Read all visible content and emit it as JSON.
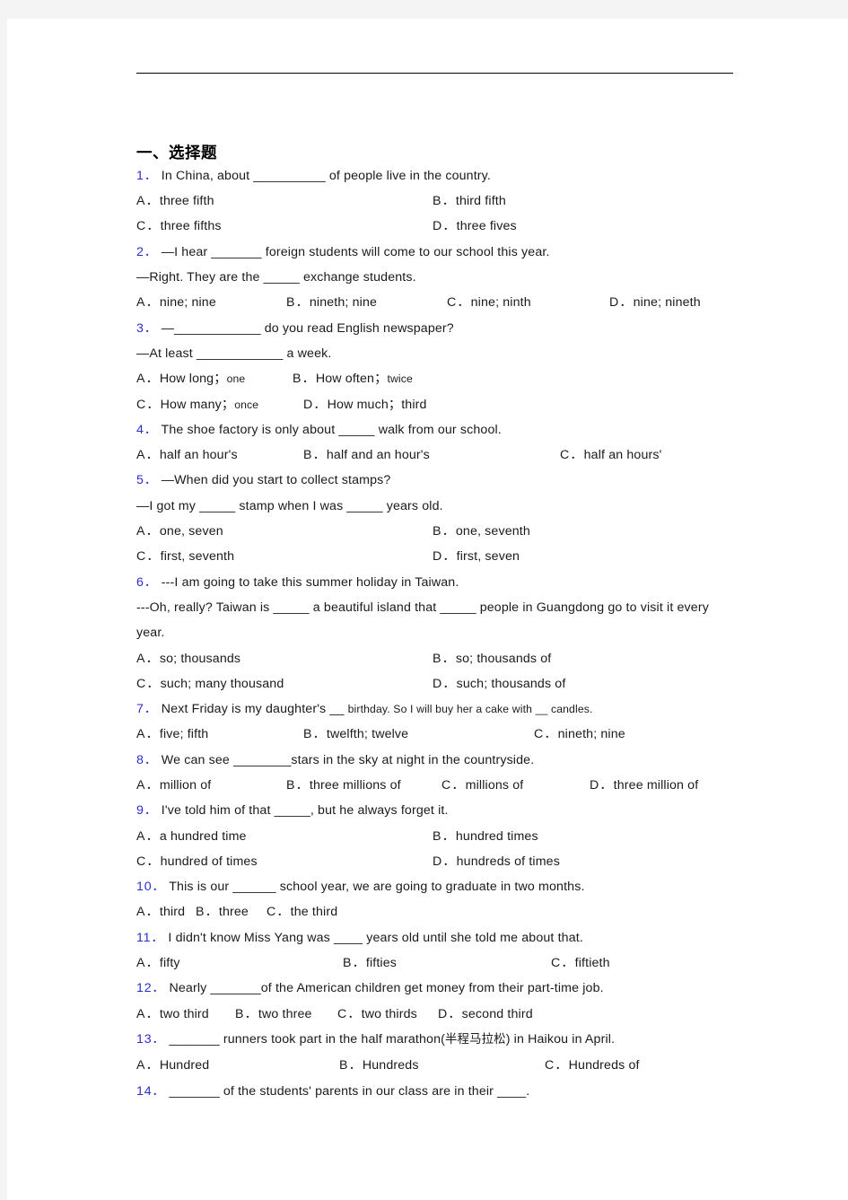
{
  "document": {
    "heading": "一、选择题",
    "questions": [
      {
        "number": "1．",
        "text": "In China, about __________ of people live in the country.",
        "layout": "2col",
        "options": [
          {
            "label": "A．",
            "text": "three fifth"
          },
          {
            "label": "B．",
            "text": "third fifth"
          },
          {
            "label": "C．",
            "text": "three fifths"
          },
          {
            "label": "D．",
            "text": "three fives"
          }
        ]
      },
      {
        "number": "2．",
        "text": "—I hear _______ foreign students will come to our school this year.",
        "text2": "—Right. They are the _____ exchange students.",
        "layout": "4col",
        "options": [
          {
            "label": "A．",
            "text": "nine; nine"
          },
          {
            "label": "B．",
            "text": "nineth; nine"
          },
          {
            "label": "C．",
            "text": "nine; ninth"
          },
          {
            "label": "D．",
            "text": "nine; nineth"
          }
        ]
      },
      {
        "number": "3．",
        "text": "—____________ do you read English newspaper?",
        "text2": " —At least ____________ a week.",
        "layout": "inline2",
        "options": [
          {
            "label": "A．",
            "text": "How long",
            "sep": "；",
            "small": "one"
          },
          {
            "label": "B．",
            "text": "How often",
            "sep": "；",
            "small": "twice"
          },
          {
            "label": "C．",
            "text": "How many",
            "sep": "；",
            "small": "once"
          },
          {
            "label": "D．",
            "text": "How much",
            "sep": "；",
            "small": "third"
          }
        ]
      },
      {
        "number": "4．",
        "text": "The shoe factory is only about _____ walk from our school.",
        "layout": "3col",
        "options": [
          {
            "label": "A．",
            "text": "half an hour's"
          },
          {
            "label": "B．",
            "text": "half and an hour's"
          },
          {
            "label": "C．",
            "text": "half an hours'"
          }
        ]
      },
      {
        "number": "5．",
        "text": "—When did you start to collect stamps?",
        "text2": "—I got my _____ stamp when I was _____ years old.",
        "layout": "2col",
        "options": [
          {
            "label": "A．",
            "text": "one, seven"
          },
          {
            "label": "B．",
            "text": "one, seventh"
          },
          {
            "label": "C．",
            "text": "first, seventh"
          },
          {
            "label": "D．",
            "text": "first, seven"
          }
        ]
      },
      {
        "number": "6．",
        "text": "---I am going to take this summer holiday in Taiwan.",
        "text2": "---Oh, really? Taiwan is _____ a beautiful island that _____ people in Guangdong go to visit it every year.",
        "layout": "2col",
        "options": [
          {
            "label": "A．",
            "text": "so; thousands"
          },
          {
            "label": "B．",
            "text": "so; thousands of"
          },
          {
            "label": "C．",
            "text": "such; many thousand"
          },
          {
            "label": "D．",
            "text": "such; thousands of"
          }
        ]
      },
      {
        "number": "7．",
        "text_a": "Next Friday is my daughter's __ ",
        "text_b": "birthday. So I will buy her a cake with __ candles.",
        "layout": "3col",
        "options": [
          {
            "label": "A．",
            "text": "five; fifth"
          },
          {
            "label": "B．",
            "text": "twelfth; twelve"
          },
          {
            "label": "C．",
            "text": "nineth; nine"
          }
        ]
      },
      {
        "number": "8．",
        "text": "We can see ________stars in the sky at night in the countryside.",
        "layout": "4col",
        "options": [
          {
            "label": "A．",
            "text": "million of"
          },
          {
            "label": "B．",
            "text": "three millions of"
          },
          {
            "label": "C．",
            "text": "millions of"
          },
          {
            "label": "D．",
            "text": "three million of"
          }
        ]
      },
      {
        "number": "9．",
        "text": "I've told him of that _____, but he always forget it.",
        "layout": "2col",
        "options": [
          {
            "label": "A．",
            "text": "a hundred time"
          },
          {
            "label": "B．",
            "text": "hundred times"
          },
          {
            "label": "C．",
            "text": "hundred of times"
          },
          {
            "label": "D．",
            "text": "hundreds of times"
          }
        ]
      },
      {
        "number": "10．",
        "text": "This is our ______ school year, we are going to graduate in two months.",
        "layout": "inline3",
        "options": [
          {
            "label": "A．",
            "text": "third"
          },
          {
            "label": "B．",
            "text": "three"
          },
          {
            "label": "C．",
            "text": "the third"
          }
        ]
      },
      {
        "number": "11．",
        "text": "I didn't know Miss Yang was ____  years old until she told me about that.",
        "layout": "3col",
        "options": [
          {
            "label": "A．",
            "text": "fifty"
          },
          {
            "label": "B．",
            "text": "fifties"
          },
          {
            "label": "C．",
            "text": "fiftieth"
          }
        ]
      },
      {
        "number": "12．",
        "text": "Nearly _______of the American children get money from their part-time job.",
        "layout": "inline4",
        "options": [
          {
            "label": "A．",
            "text": "two third"
          },
          {
            "label": "B．",
            "text": "two three"
          },
          {
            "label": "C．",
            "text": "two thirds"
          },
          {
            "label": "D．",
            "text": "second third"
          }
        ]
      },
      {
        "number": "13．",
        "text_pre": " _______ runners took part in the half marathon(",
        "text_cn": "半程马拉松",
        "text_post": ") in Haikou in April.",
        "layout": "3col",
        "options": [
          {
            "label": "A．",
            "text": "Hundred"
          },
          {
            "label": "B．",
            "text": "Hundreds"
          },
          {
            "label": "C．",
            "text": "Hundreds of"
          }
        ]
      },
      {
        "number": "14．",
        "text": " _______ of the students' parents in our class are in their ____.",
        "layout": "none",
        "options": []
      }
    ]
  }
}
